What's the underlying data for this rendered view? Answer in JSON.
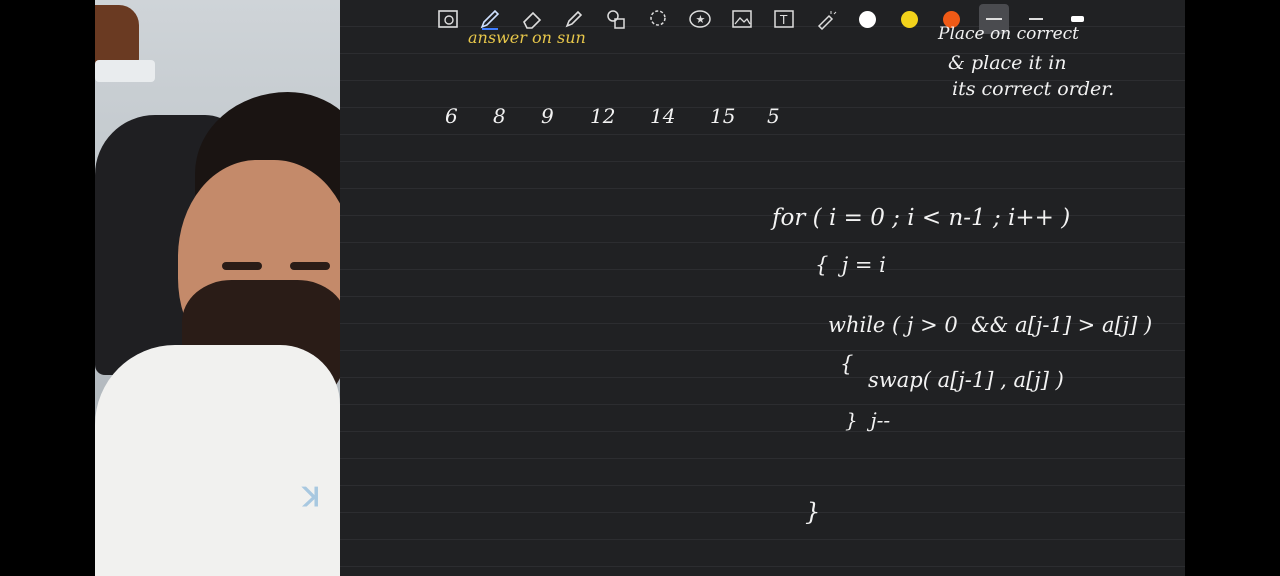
{
  "toolbar": {
    "tools": [
      {
        "name": "lasso-view-icon",
        "glyph": "▣"
      },
      {
        "name": "pen-tool-icon",
        "glyph": "✎"
      },
      {
        "name": "eraser-icon",
        "glyph": "⌫"
      },
      {
        "name": "highlighter-icon",
        "glyph": "✐"
      },
      {
        "name": "shapes-icon",
        "glyph": "◇"
      },
      {
        "name": "lasso-icon",
        "glyph": "◯"
      },
      {
        "name": "sticker-icon",
        "glyph": "★"
      },
      {
        "name": "image-icon",
        "glyph": "▨"
      },
      {
        "name": "text-icon",
        "glyph": "T"
      },
      {
        "name": "laser-icon",
        "glyph": "✦"
      }
    ],
    "colors": [
      "#ffffff",
      "#f2d21b",
      "#ef5a16"
    ],
    "thicknesses": [
      "thin",
      "medium",
      "thick"
    ]
  },
  "notes": {
    "top_left_partial": "answer on sun",
    "top_right_partial": "Place on correct",
    "top_right_line2": "& place it in",
    "top_right_line3": "its correct order.",
    "numbers": [
      "6",
      "8",
      "9",
      "12",
      "14",
      "15",
      "5"
    ],
    "code_for": "for ( i = 0 ; i < n-1 ; i++ )",
    "code_brace_open": "{  j = i",
    "code_while": "while ( j > 0  && a[j-1] > a[j] )",
    "code_brace_while": "{",
    "code_swap": "swap( a[j-1] , a[j] )",
    "code_decr": "}  j--",
    "code_brace_close": "}"
  }
}
